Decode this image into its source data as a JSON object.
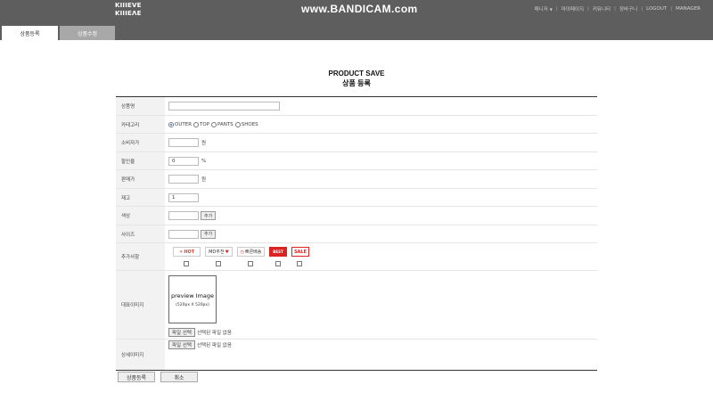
{
  "header": {
    "logo_top": "KIIIEVE",
    "logo_bottom": "KIIIEVE",
    "watermark": "www.BANDICAM.com",
    "nav": [
      "매니저",
      "마이페이지",
      "커뮤니티",
      "장바구니",
      "LOGOUT",
      "MANAGER"
    ]
  },
  "tabs": [
    {
      "label": "상품등록",
      "active": true
    },
    {
      "label": "상품수정",
      "active": false
    }
  ],
  "title": {
    "en": "PRODUCT SAVE",
    "ko": "상품 등록"
  },
  "form": {
    "product_name_label": "상품명",
    "product_name_value": "",
    "category_label": "카테고리",
    "categories": [
      {
        "label": "OUTER",
        "checked": true
      },
      {
        "label": "TOP",
        "checked": false
      },
      {
        "label": "PANTS",
        "checked": false
      },
      {
        "label": "SHOES",
        "checked": false
      }
    ],
    "consumer_price_label": "소비자가",
    "consumer_price_value": "",
    "consumer_price_unit": "원",
    "discount_label": "할인율",
    "discount_value": "0",
    "discount_unit": "%",
    "sale_price_label": "판매가",
    "sale_price_value": "",
    "sale_price_unit": "원",
    "stock_label": "재고",
    "stock_value": "1",
    "color_label": "색상",
    "color_value": "",
    "color_add": "추가",
    "size_label": "사이즈",
    "size_value": "",
    "size_add": "추가",
    "extra_label": "추가사항",
    "badges": [
      "HOT",
      "MD추천",
      "빠른배송",
      "BEST",
      "SALE"
    ],
    "main_image_label": "대표이미지",
    "preview_title": "preview Image",
    "preview_size": "(520px X 520px)",
    "file_button": "파일 선택",
    "no_file": "선택된 파일 없음",
    "detail_image_label": "상세이미지"
  },
  "buttons": {
    "submit": "상품등록",
    "cancel": "취소"
  },
  "colors": {
    "header_bg": "#5f5e5f",
    "tab_inactive": "#a8a8a8",
    "label_bg": "#f2f2f2"
  }
}
